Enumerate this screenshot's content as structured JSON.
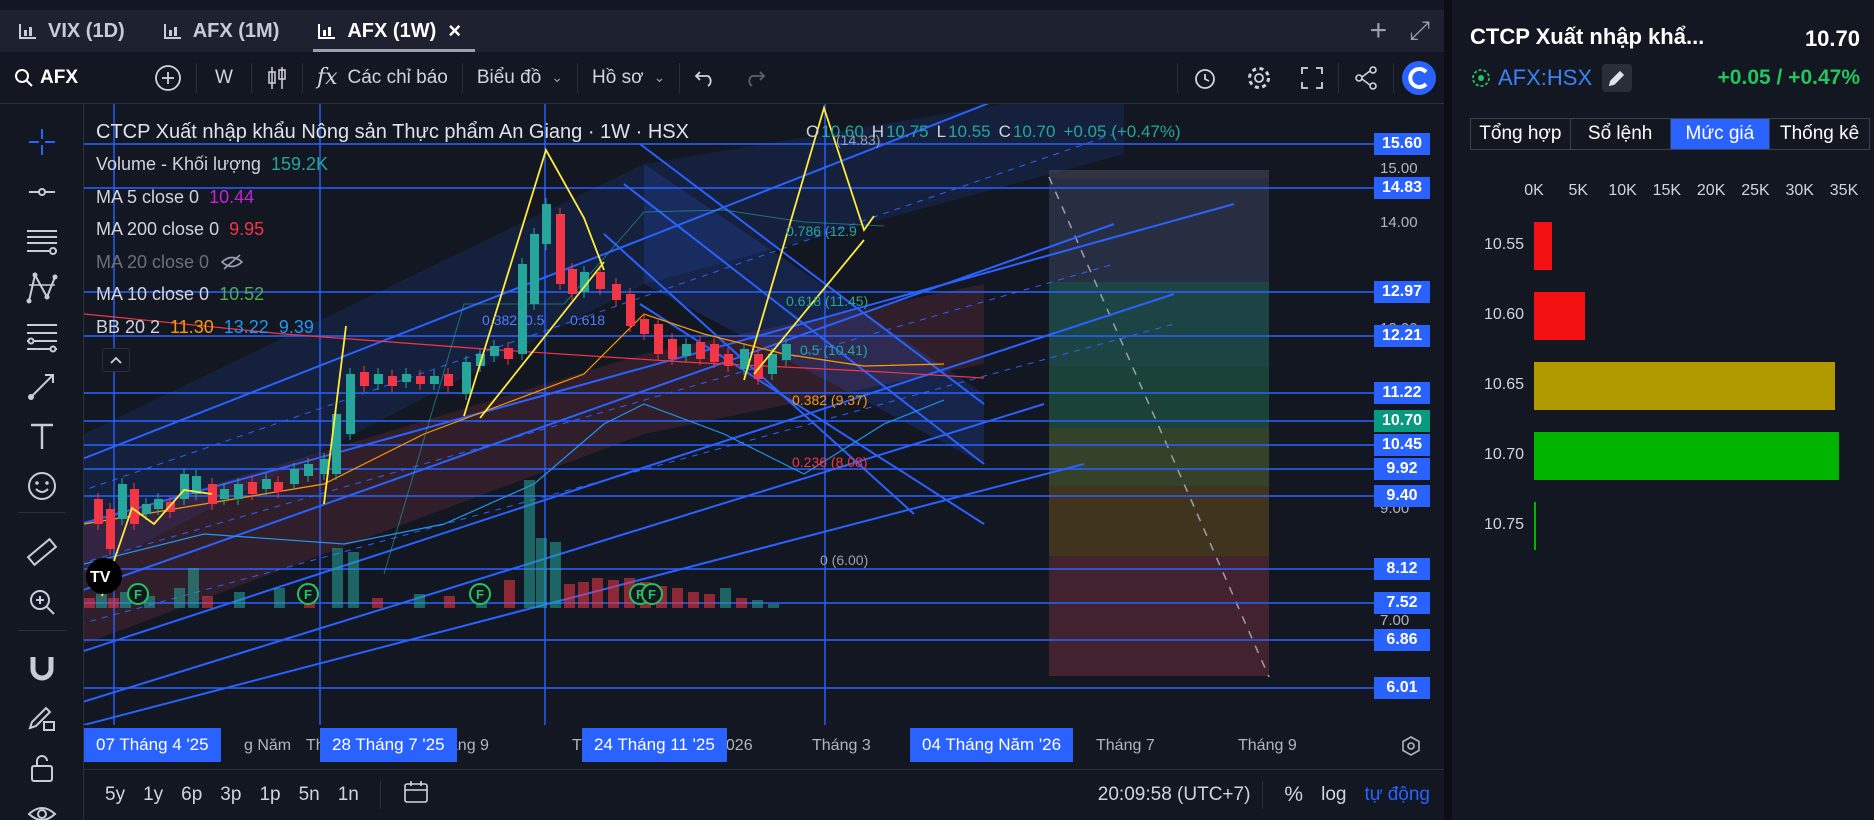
{
  "tabs": [
    {
      "label": "VIX (1D)",
      "active": false
    },
    {
      "label": "AFX (1M)",
      "active": false
    },
    {
      "label": "AFX (1W)",
      "active": true
    }
  ],
  "tab_actions": {
    "add": "+",
    "expand": "⤢"
  },
  "toolbar": {
    "symbol": "AFX",
    "interval": "W",
    "indicators_label": "Các chỉ báo",
    "chart_type_label": "Biểu đồ",
    "profile_label": "Hồ sơ"
  },
  "legend": {
    "title": "CTCP Xuất nhập khẩu Nông sản Thực phẩm An Giang · 1W · HSX",
    "ohlc": {
      "o_label": "O",
      "o": "10.60",
      "h_label": "H",
      "h": "10.75",
      "l_label": "L",
      "l": "10.55",
      "c_label": "C",
      "c": "10.70",
      "change": "+0.05 (+0.47%)"
    },
    "volume": {
      "name": "Volume - Khối lượng",
      "value": "159.2K"
    },
    "ma5": {
      "name": "MA 5 close 0",
      "value": "10.44"
    },
    "ma200": {
      "name": "MA 200 close 0",
      "value": "9.95"
    },
    "ma20": {
      "name": "MA 20 close 0",
      "value": ""
    },
    "ma10": {
      "name": "MA 10 close 0",
      "value": "10.52"
    },
    "bb": {
      "name": "BB 20 2",
      "v1": "11.30",
      "v2": "13.22",
      "v3": "9.39"
    }
  },
  "price_labels": [
    "15.60",
    "14.83",
    "12.97",
    "12.21",
    "11.22",
    "10.70",
    "10.45",
    "9.92",
    "9.40",
    "8.12",
    "7.52",
    "6.86",
    "6.01"
  ],
  "price_axis": [
    "15.00",
    "14.00",
    "12.00",
    "11.00",
    "9.00",
    "7.00"
  ],
  "fib_labels": [
    "0.786 (12.9",
    "0.618 (11.45)",
    "0.5 (10.41)",
    "0.382 (9.37)",
    "0.236 (8.08)",
    "0 (6.00)",
    "(14.83)"
  ],
  "pitchfork_labels": [
    "0.382",
    "0.5",
    "0.618"
  ],
  "time_axis": {
    "labels": [
      "g Năm",
      "Th",
      "háng 9",
      "Th",
      "2026",
      "Tháng 3",
      "Tháng 7",
      "Tháng 9"
    ],
    "selected": [
      "07 Tháng 4 '25",
      "28 Tháng 7 '25",
      "24 Tháng 11 '25",
      "04 Tháng Năm '26"
    ]
  },
  "event_marker": "F",
  "bottom_bar": {
    "ranges": [
      "5y",
      "1y",
      "6p",
      "3p",
      "1p",
      "5n",
      "1n"
    ],
    "time": "20:09:58 (UTC+7)",
    "percent": "%",
    "log": "log",
    "auto": "tự động"
  },
  "right_panel": {
    "title": "CTCP Xuất nhập khẩ...",
    "price": "10.70",
    "ticker": "AFX:HSX",
    "change": "+0.05 / +0.47%",
    "tabs": [
      "Tổng hợp",
      "Sổ lệnh",
      "Mức giá",
      "Thống kê"
    ],
    "active_tab": "Mức giá",
    "axis": [
      "0K",
      "5K",
      "10K",
      "15K",
      "20K",
      "25K",
      "30K",
      "35K"
    ],
    "axis_max": 35000,
    "levels": [
      {
        "price": "10.55",
        "volume": 2000,
        "color": "#f21010"
      },
      {
        "price": "10.60",
        "volume": 5800,
        "color": "#f21010"
      },
      {
        "price": "10.65",
        "volume": 34000,
        "color": "#b09a00"
      },
      {
        "price": "10.70",
        "volume": 34400,
        "color": "#00b400"
      },
      {
        "price": "10.75",
        "volume": 200,
        "color": "#00b400"
      }
    ]
  },
  "colors": {
    "accent": "#2962ff",
    "up": "#26a69a",
    "down": "#f23645",
    "fib_line": "#2962ff",
    "arrow": "#ffeb3b"
  }
}
